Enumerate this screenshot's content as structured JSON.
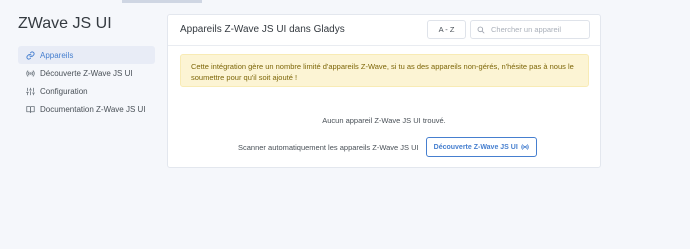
{
  "sidebar": {
    "title": "ZWave JS UI",
    "items": [
      {
        "label": "Appareils",
        "icon": "link-icon",
        "active": true
      },
      {
        "label": "Découverte Z-Wave JS UI",
        "icon": "radio-icon",
        "active": false
      },
      {
        "label": "Configuration",
        "icon": "sliders-icon",
        "active": false
      },
      {
        "label": "Documentation Z-Wave JS UI",
        "icon": "book-icon",
        "active": false
      }
    ]
  },
  "main": {
    "title": "Appareils Z-Wave JS UI dans Gladys",
    "sort_value": "A - Z",
    "search_placeholder": "Chercher un appareil",
    "alert_text": "Cette intégration gère un nombre limité d'appareils Z-Wave, si tu as des appareils non-gérés, n'hésite pas à nous le soumettre pour qu'il soit ajouté !",
    "empty_text": "Aucun appareil Z-Wave JS UI trouvé.",
    "scan_label": "Scanner automatiquement les appareils Z-Wave JS UI",
    "scan_button_label": "Découverte Z-Wave JS UI"
  },
  "colors": {
    "accent": "#467fcf",
    "alert_bg": "#fcf4d4",
    "alert_text": "#7d6608"
  }
}
